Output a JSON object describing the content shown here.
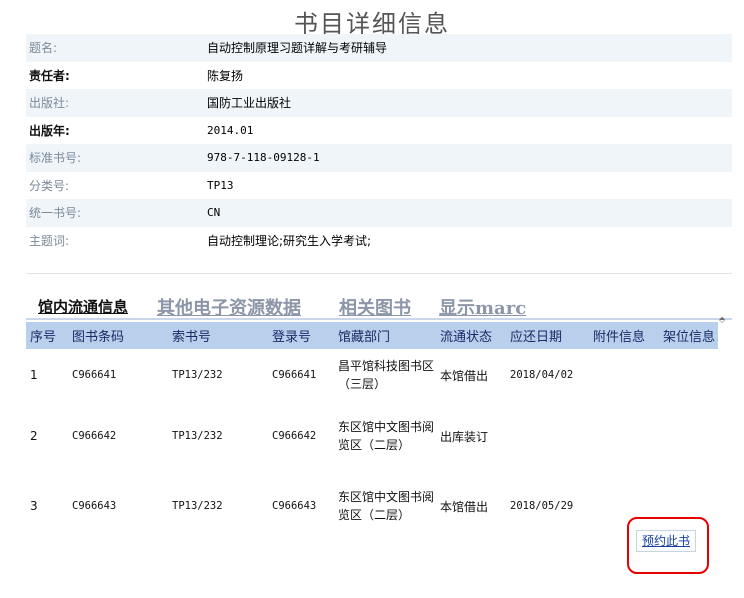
{
  "page_title": "书目详细信息",
  "info": [
    {
      "label": "题名:",
      "value": "自动控制原理习题详解与考研辅导",
      "bold": false,
      "mono": false
    },
    {
      "label": "责任者:",
      "value": "陈复扬",
      "bold": true,
      "mono": false
    },
    {
      "label": "出版社:",
      "value": "国防工业出版社",
      "bold": false,
      "mono": false
    },
    {
      "label": "出版年:",
      "value": "2014.01",
      "bold": true,
      "mono": true
    },
    {
      "label": "标准书号:",
      "value": "978-7-118-09128-1",
      "bold": false,
      "mono": true
    },
    {
      "label": "分类号:",
      "value": "TP13",
      "bold": false,
      "mono": true
    },
    {
      "label": "统一书号:",
      "value": "CN",
      "bold": false,
      "mono": true
    },
    {
      "label": "主题词:",
      "value": "自动控制理论;研究生入学考试;",
      "bold": false,
      "mono": false
    }
  ],
  "tabs": [
    "馆内流通信息",
    "其他电子资源数据",
    "相关图书",
    "显示marc"
  ],
  "holdings": {
    "headers": [
      "序号",
      "图书条码",
      "索书号",
      "登录号",
      "馆藏部门",
      "流通状态",
      "应还日期",
      "附件信息",
      "架位信息"
    ],
    "rows": [
      {
        "no": "1",
        "barcode": "C966641",
        "call_no": "TP13/232",
        "reg_no": "C966641",
        "location": "昌平馆科技图书区（三层）",
        "status": "本馆借出",
        "due": "2018/04/02",
        "attachment": "",
        "shelf": ""
      },
      {
        "no": "2",
        "barcode": "C966642",
        "call_no": "TP13/232",
        "reg_no": "C966642",
        "location": "东区馆中文图书阅览区（二层）",
        "status": "出库装订",
        "due": "",
        "attachment": "",
        "shelf": ""
      },
      {
        "no": "3",
        "barcode": "C966643",
        "call_no": "TP13/232",
        "reg_no": "C966643",
        "location": "东区馆中文图书阅览区（二层）",
        "status": "本馆借出",
        "due": "2018/05/29",
        "attachment": "",
        "shelf": ""
      }
    ]
  },
  "reserve_label": "预约此书",
  "scroll_glyph": "⬘"
}
